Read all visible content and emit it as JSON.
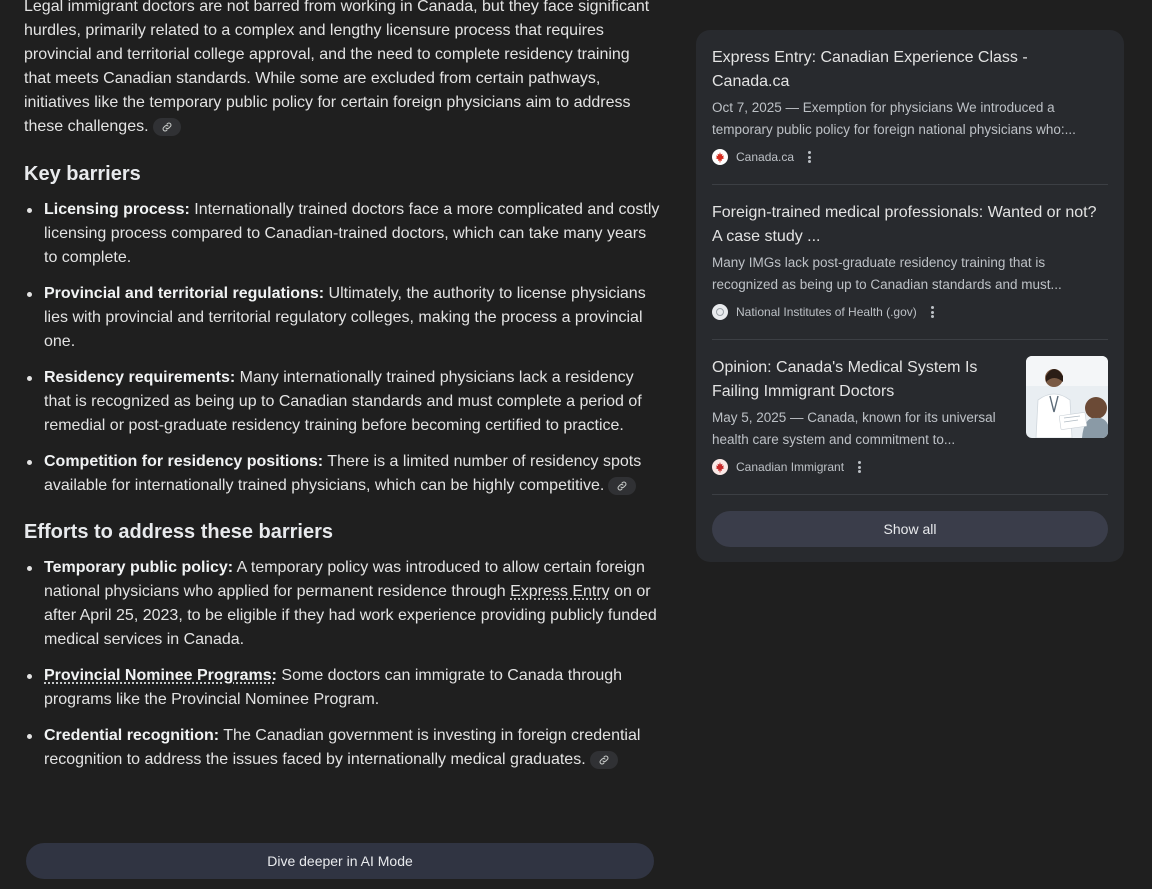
{
  "intro": "Legal immigrant doctors are not barred from working in Canada, but they face significant hurdles, primarily related to a complex and lengthy licensure process that requires provincial and territorial college approval, and the need to complete residency training that meets Canadian standards. While some are excluded from certain pathways, initiatives like the temporary public policy for certain foreign physicians aim to address these challenges.",
  "section1": {
    "heading": "Key barriers",
    "items": [
      {
        "label": "Licensing process:",
        "text": " Internationally trained doctors face a more complicated and costly licensing process compared to Canadian-trained doctors, which can take many years to complete."
      },
      {
        "label": "Provincial and territorial regulations:",
        "text": " Ultimately, the authority to license physicians lies with provincial and territorial regulatory colleges, making the process a provincial one."
      },
      {
        "label": "Residency requirements:",
        "text": " Many internationally trained physicians lack a residency that is recognized as being up to Canadian standards and must complete a period of remedial or post-graduate residency training before becoming certified to practice."
      },
      {
        "label": "Competition for residency positions:",
        "text": " There is a limited number of residency spots available for internationally trained physicians, which can be highly competitive."
      }
    ]
  },
  "section2": {
    "heading": "Efforts to address these barriers",
    "item1": {
      "label": "Temporary public policy:",
      "text_a": " A temporary policy was introduced to allow certain foreign national physicians who applied for permanent residence through ",
      "link": "Express Entry",
      "text_b": " on or after April 25, 2023, to be eligible if they had work experience providing publicly funded medical services in Canada."
    },
    "item2": {
      "label": "Provincial Nominee Programs:",
      "text": " Some doctors can immigrate to Canada through programs like the Provincial Nominee Program."
    },
    "item3": {
      "label": "Credential recognition:",
      "text": " The Canadian government is investing in foreign credential recognition to address the issues faced by internationally medical graduates."
    }
  },
  "dive_button": "Dive deeper in AI Mode",
  "sources": [
    {
      "title": "Express Entry: Canadian Experience Class - Canada.ca",
      "snippet": "Oct 7, 2025 — Exemption for physicians We introduced a temporary public policy for foreign national physicians who:...",
      "site": "Canada.ca",
      "icon": "maple-leaf-icon"
    },
    {
      "title": "Foreign-trained medical professionals: Wanted or not? A case study ...",
      "snippet": "Many IMGs lack post-graduate residency training that is recognized as being up to Canadian standards and must...",
      "site": "National Institutes of Health (.gov)",
      "icon": "nih-icon"
    },
    {
      "title": "Opinion: Canada's Medical System Is Failing Immigrant Doctors",
      "snippet": "May 5, 2025 — Canada, known for its universal health care system and commitment to...",
      "site": "Canadian Immigrant",
      "icon": "maple-leaf-icon"
    }
  ],
  "show_all": "Show all",
  "colors": {
    "background": "#1f1f1f",
    "card": "#282a2e",
    "button": "#303442",
    "text": "#e3e3e3"
  }
}
